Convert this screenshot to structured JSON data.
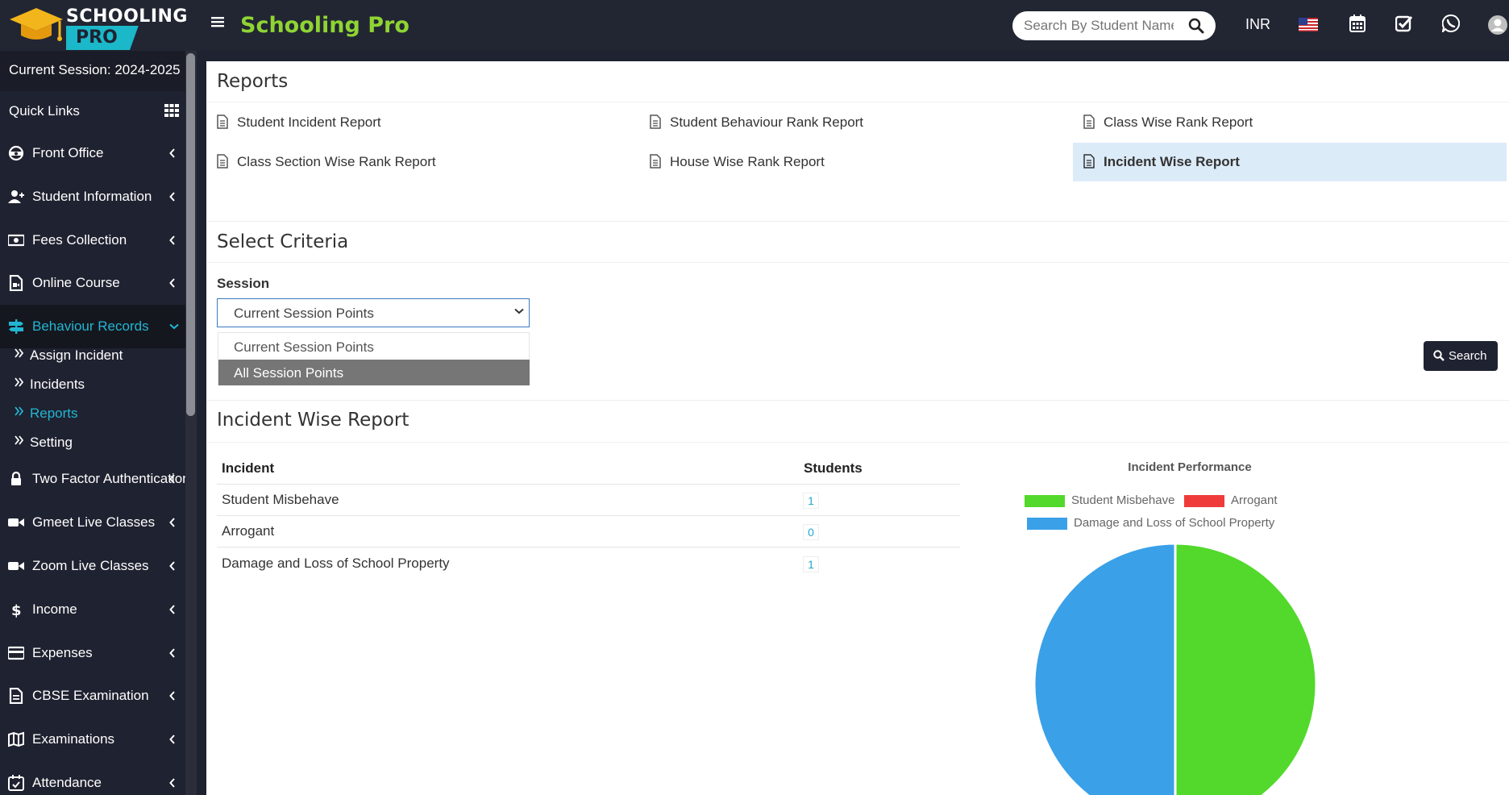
{
  "header": {
    "logo_line1": "SCHOOLING",
    "logo_line2": "PRO",
    "title": "Schooling Pro",
    "search_placeholder": "Search By Student Name",
    "currency": "INR"
  },
  "sidebar": {
    "session": "Current Session: 2024-2025",
    "quick_links": "Quick Links",
    "items": [
      {
        "label": "Front Office",
        "icon": "headset-icon"
      },
      {
        "label": "Student Information",
        "icon": "user-plus-icon"
      },
      {
        "label": "Fees Collection",
        "icon": "money-icon"
      },
      {
        "label": "Online Course",
        "icon": "file-video-icon"
      },
      {
        "label": "Behaviour Records",
        "icon": "signpost-icon",
        "active": true
      },
      {
        "label": "Two Factor Authentication",
        "icon": "lock-icon"
      },
      {
        "label": "Gmeet Live Classes",
        "icon": "video-icon"
      },
      {
        "label": "Zoom Live Classes",
        "icon": "video-icon"
      },
      {
        "label": "Income",
        "icon": "dollar-icon"
      },
      {
        "label": "Expenses",
        "icon": "credit-card-icon"
      },
      {
        "label": "CBSE Examination",
        "icon": "file-icon"
      },
      {
        "label": "Examinations",
        "icon": "map-icon"
      },
      {
        "label": "Attendance",
        "icon": "calendar-check-icon"
      }
    ],
    "subitems": [
      {
        "label": "Assign Incident"
      },
      {
        "label": "Incidents"
      },
      {
        "label": "Reports",
        "active": true
      },
      {
        "label": "Setting"
      }
    ]
  },
  "reports": {
    "title": "Reports",
    "links": [
      "Student Incident Report",
      "Student Behaviour Rank Report",
      "Class Wise Rank Report",
      "Class Section Wise Rank Report",
      "House Wise Rank Report",
      "Incident Wise Report"
    ]
  },
  "criteria": {
    "title": "Select Criteria",
    "session_label": "Session",
    "selected": "Current Session Points",
    "options": [
      "Current Session Points",
      "All Session Points"
    ],
    "search_button": "Search"
  },
  "report": {
    "title": "Incident Wise Report",
    "col_incident": "Incident",
    "col_students": "Students",
    "rows": [
      {
        "incident": "Student Misbehave",
        "students": "1"
      },
      {
        "incident": "Arrogant",
        "students": "0"
      },
      {
        "incident": "Damage and Loss of School Property",
        "students": "1"
      }
    ]
  },
  "chart_data": {
    "type": "pie",
    "title": "Incident Performance",
    "categories": [
      "Student Misbehave",
      "Arrogant",
      "Damage and Loss of School Property"
    ],
    "values": [
      1,
      0,
      1
    ],
    "colors": [
      "#52d92b",
      "#f03b3b",
      "#3aa0e8"
    ],
    "legend": "top"
  }
}
